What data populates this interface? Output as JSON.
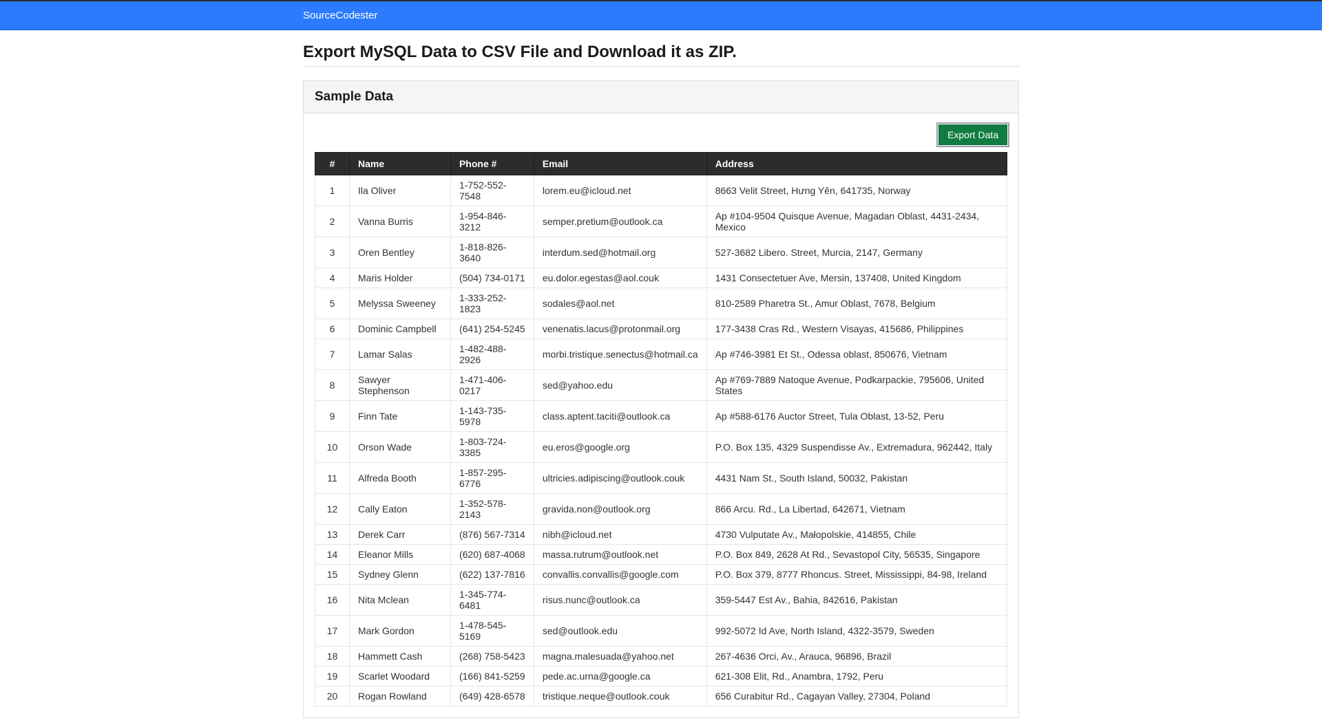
{
  "navbar": {
    "brand": "SourceCodester"
  },
  "page": {
    "title": "Export MySQL Data to CSV File and Download it as ZIP."
  },
  "card": {
    "title": "Sample Data",
    "export_label": "Export Data",
    "columns": {
      "num": "#",
      "name": "Name",
      "phone": "Phone #",
      "email": "Email",
      "address": "Address"
    },
    "rows": [
      {
        "num": "1",
        "name": "Ila Oliver",
        "phone": "1-752-552-7548",
        "email": "lorem.eu@icloud.net",
        "address": "8663 Velit Street, Hưng Yên, 641735, Norway"
      },
      {
        "num": "2",
        "name": "Vanna Burris",
        "phone": "1-954-846-3212",
        "email": "semper.pretium@outlook.ca",
        "address": "Ap #104-9504 Quisque Avenue, Magadan Oblast, 4431-2434, Mexico"
      },
      {
        "num": "3",
        "name": "Oren Bentley",
        "phone": "1-818-826-3640",
        "email": "interdum.sed@hotmail.org",
        "address": "527-3682 Libero. Street, Murcia, 2147, Germany"
      },
      {
        "num": "4",
        "name": "Maris Holder",
        "phone": "(504) 734-0171",
        "email": "eu.dolor.egestas@aol.couk",
        "address": "1431 Consectetuer Ave, Mersin, 137408, United Kingdom"
      },
      {
        "num": "5",
        "name": "Melyssa Sweeney",
        "phone": "1-333-252-1823",
        "email": "sodales@aol.net",
        "address": "810-2589 Pharetra St., Amur Oblast, 7678, Belgium"
      },
      {
        "num": "6",
        "name": "Dominic Campbell",
        "phone": "(641) 254-5245",
        "email": "venenatis.lacus@protonmail.org",
        "address": "177-3438 Cras Rd., Western Visayas, 415686, Philippines"
      },
      {
        "num": "7",
        "name": "Lamar Salas",
        "phone": "1-482-488-2926",
        "email": "morbi.tristique.senectus@hotmail.ca",
        "address": "Ap #746-3981 Et St., Odessa oblast, 850676, Vietnam"
      },
      {
        "num": "8",
        "name": "Sawyer Stephenson",
        "phone": "1-471-406-0217",
        "email": "sed@yahoo.edu",
        "address": "Ap #769-7889 Natoque Avenue, Podkarpackie, 795606, United States"
      },
      {
        "num": "9",
        "name": "Finn Tate",
        "phone": "1-143-735-5978",
        "email": "class.aptent.taciti@outlook.ca",
        "address": "Ap #588-6176 Auctor Street, Tula Oblast, 13-52, Peru"
      },
      {
        "num": "10",
        "name": "Orson Wade",
        "phone": "1-803-724-3385",
        "email": "eu.eros@google.org",
        "address": "P.O. Box 135, 4329 Suspendisse Av., Extremadura, 962442, Italy"
      },
      {
        "num": "11",
        "name": "Alfreda Booth",
        "phone": "1-857-295-6776",
        "email": "ultricies.adipiscing@outlook.couk",
        "address": "4431 Nam St., South Island, 50032, Pakistan"
      },
      {
        "num": "12",
        "name": "Cally Eaton",
        "phone": "1-352-578-2143",
        "email": "gravida.non@outlook.org",
        "address": "866 Arcu. Rd., La Libertad, 642671, Vietnam"
      },
      {
        "num": "13",
        "name": "Derek Carr",
        "phone": "(876) 567-7314",
        "email": "nibh@icloud.net",
        "address": "4730 Vulputate Av., Małopolskie, 414855, Chile"
      },
      {
        "num": "14",
        "name": "Eleanor Mills",
        "phone": "(620) 687-4068",
        "email": "massa.rutrum@outlook.net",
        "address": "P.O. Box 849, 2628 At Rd., Sevastopol City, 56535, Singapore"
      },
      {
        "num": "15",
        "name": "Sydney Glenn",
        "phone": "(622) 137-7816",
        "email": "convallis.convallis@google.com",
        "address": "P.O. Box 379, 8777 Rhoncus. Street, Mississippi, 84-98, Ireland"
      },
      {
        "num": "16",
        "name": "Nita Mclean",
        "phone": "1-345-774-6481",
        "email": "risus.nunc@outlook.ca",
        "address": "359-5447 Est Av., Bahia, 842616, Pakistan"
      },
      {
        "num": "17",
        "name": "Mark Gordon",
        "phone": "1-478-545-5169",
        "email": "sed@outlook.edu",
        "address": "992-5072 Id Ave, North Island, 4322-3579, Sweden"
      },
      {
        "num": "18",
        "name": "Hammett Cash",
        "phone": "(268) 758-5423",
        "email": "magna.malesuada@yahoo.net",
        "address": "267-4636 Orci, Av., Arauca, 96896, Brazil"
      },
      {
        "num": "19",
        "name": "Scarlet Woodard",
        "phone": "(166) 841-5259",
        "email": "pede.ac.urna@google.ca",
        "address": "621-308 Elit, Rd., Anambra, 1792, Peru"
      },
      {
        "num": "20",
        "name": "Rogan Rowland",
        "phone": "(649) 428-6578",
        "email": "tristique.neque@outlook.couk",
        "address": "656 Curabitur Rd., Cagayan Valley, 27304, Poland"
      }
    ]
  }
}
